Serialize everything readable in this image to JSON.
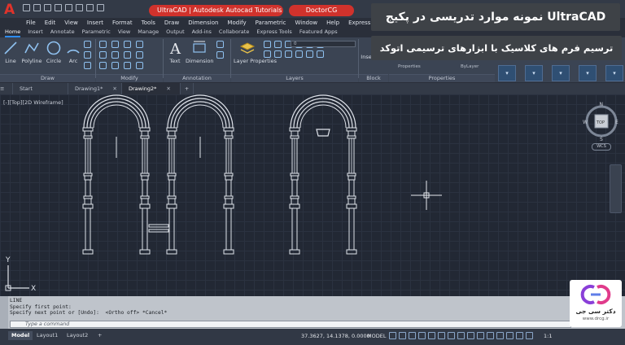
{
  "title_bar": {
    "app_logo": "A",
    "tutorial_banner": "UltraCAD | Autodesk Autocad Tutorials",
    "brand_banner": "DoctorCG"
  },
  "menu_bar": [
    "File",
    "Edit",
    "View",
    "Insert",
    "Format",
    "Tools",
    "Draw",
    "Dimension",
    "Modify",
    "Parametric",
    "Window",
    "Help",
    "Express"
  ],
  "ribbon_tabs": [
    "Home",
    "Insert",
    "Annotate",
    "Parametric",
    "View",
    "Manage",
    "Output",
    "Add-ins",
    "Collaborate",
    "Express Tools",
    "Featured Apps"
  ],
  "ribbon": {
    "draw_tools": [
      "Line",
      "Polyline",
      "Circle",
      "Arc"
    ],
    "annotation_tools": [
      "Text",
      "Dimension"
    ],
    "layer_tool": "Layer Properties",
    "layer_value": "0",
    "insert_label": "Inse",
    "properties_label": "Properties",
    "bylayer_label": "ByLayer",
    "panels": [
      "Draw",
      "Modify",
      "Annotation",
      "Layers",
      "Block",
      "Properties"
    ]
  },
  "overlay": {
    "headline": "نمونه موارد تدریسی در پکیج UltraCAD",
    "subline": "ترسیم فرم های کلاسیک با ابزارهای ترسیمی اتوکد"
  },
  "doc_tabs": [
    "Start",
    "Drawing1*",
    "Drawing2*"
  ],
  "viewport": {
    "label": "[-][Top][2D Wireframe]",
    "viewcube_top": "TOP",
    "compass": {
      "n": "N",
      "s": "S",
      "e": "E",
      "w": "W"
    },
    "wcs": "WCS",
    "ucs_x": "X",
    "ucs_y": "Y"
  },
  "command_line": {
    "history": [
      "LINE",
      "Specify first point:",
      "Specify next point or [Undo]:  <Ortho off> *Cancel*"
    ],
    "placeholder": "Type a command"
  },
  "status_bar": {
    "layouts": [
      "Model",
      "Layout1",
      "Layout2"
    ],
    "coordinates": "37.3627, 14.1378, 0.0000",
    "mode": "MODEL",
    "scale": "1:1"
  },
  "watermark": {
    "text": "دکتر سی جی",
    "url": "www.drcg.ir"
  },
  "colors": {
    "accent": "#d0322c",
    "viewport_bg": "#222834",
    "geometry": "#dfe3ea"
  }
}
